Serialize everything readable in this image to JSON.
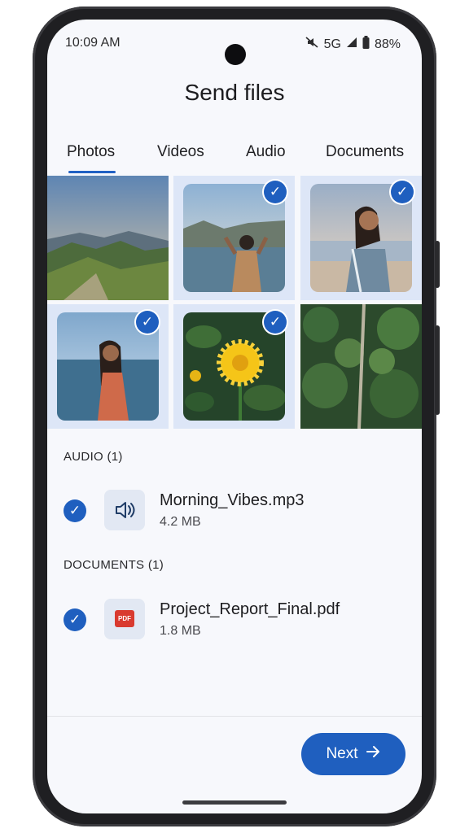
{
  "status_bar": {
    "time": "10:09 AM",
    "network": "5G",
    "battery": "88%",
    "icons": [
      "mute-icon",
      "signal-icon",
      "battery-icon"
    ]
  },
  "title": "Send files",
  "tabs": [
    {
      "label": "Photos",
      "active": true
    },
    {
      "label": "Videos",
      "active": false
    },
    {
      "label": "Audio",
      "active": false
    },
    {
      "label": "Documents",
      "active": false
    }
  ],
  "photos": [
    {
      "subject": "mountain landscape",
      "selected": false
    },
    {
      "subject": "woman by lake",
      "selected": true
    },
    {
      "subject": "woman at beach",
      "selected": true
    },
    {
      "subject": "woman by sea",
      "selected": true
    },
    {
      "subject": "yellow flower",
      "selected": true
    },
    {
      "subject": "forest road aerial",
      "selected": false
    }
  ],
  "audio": {
    "heading": "AUDIO (1)",
    "files": [
      {
        "name": "Morning_Vibes.mp3",
        "size": "4.2 MB",
        "icon": "speaker-icon",
        "selected": true
      }
    ]
  },
  "documents": {
    "heading": "DOCUMENTS (1)",
    "files": [
      {
        "name": "Project_Report_Final.pdf",
        "size": "1.8 MB",
        "icon": "pdf-icon",
        "badge": "PDF",
        "selected": true
      }
    ]
  },
  "next_button": {
    "label": "Next",
    "icon": "arrow-right-icon"
  },
  "colors": {
    "accent": "#1f5fbf",
    "selected_bg": "#dde6f7",
    "pdf_red": "#d93a2f"
  }
}
